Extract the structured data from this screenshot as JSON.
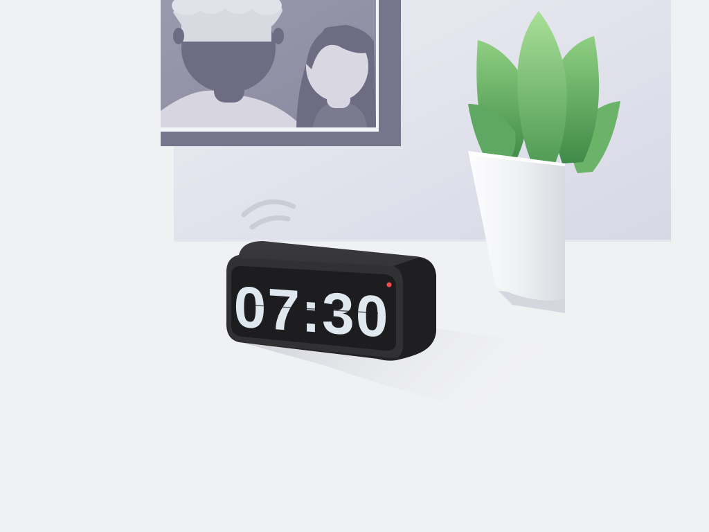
{
  "scene": {
    "background": "#f0f1f3",
    "wall_panel_color": "#dfe0ea",
    "frame_color": "#7b7a8f",
    "plant_color": "#7bbd73",
    "pot_color": "#eef0f2",
    "clock_body_color": "#2a2a2c",
    "clock_screen_color": "#1e1e20",
    "clock_digit_color": "#dfe7ef",
    "indicator_color": "#ff4d4d"
  },
  "clock": {
    "time": "07:30"
  },
  "icons": {
    "wave": "sound-wave-icon",
    "indicator": "alarm-indicator-dot"
  }
}
